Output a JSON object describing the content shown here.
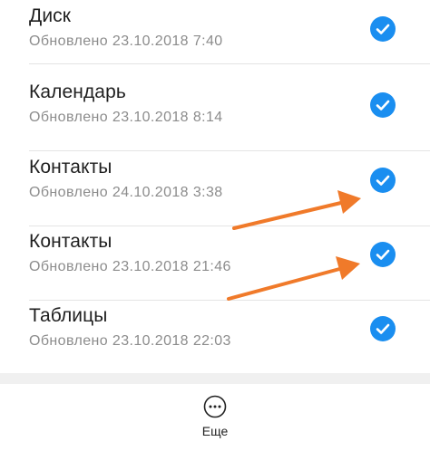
{
  "sync_items": [
    {
      "title": "Диск",
      "updated": "Обновлено 23.10.2018 7:40",
      "checked": true
    },
    {
      "title": "Календарь",
      "updated": "Обновлено 23.10.2018 8:14",
      "checked": true
    },
    {
      "title": "Контакты",
      "updated": "Обновлено 24.10.2018 3:38",
      "checked": true
    },
    {
      "title": "Контакты",
      "updated": "Обновлено 23.10.2018 21:46",
      "checked": true
    },
    {
      "title": "Таблицы",
      "updated": "Обновлено 23.10.2018 22:03",
      "checked": true
    }
  ],
  "bottom_bar": {
    "more_label": "Еще",
    "more_icon": "more-horizontal-circle-icon"
  },
  "colors": {
    "check": "#1a8ef0",
    "annotation_arrow": "#f07a2a"
  }
}
